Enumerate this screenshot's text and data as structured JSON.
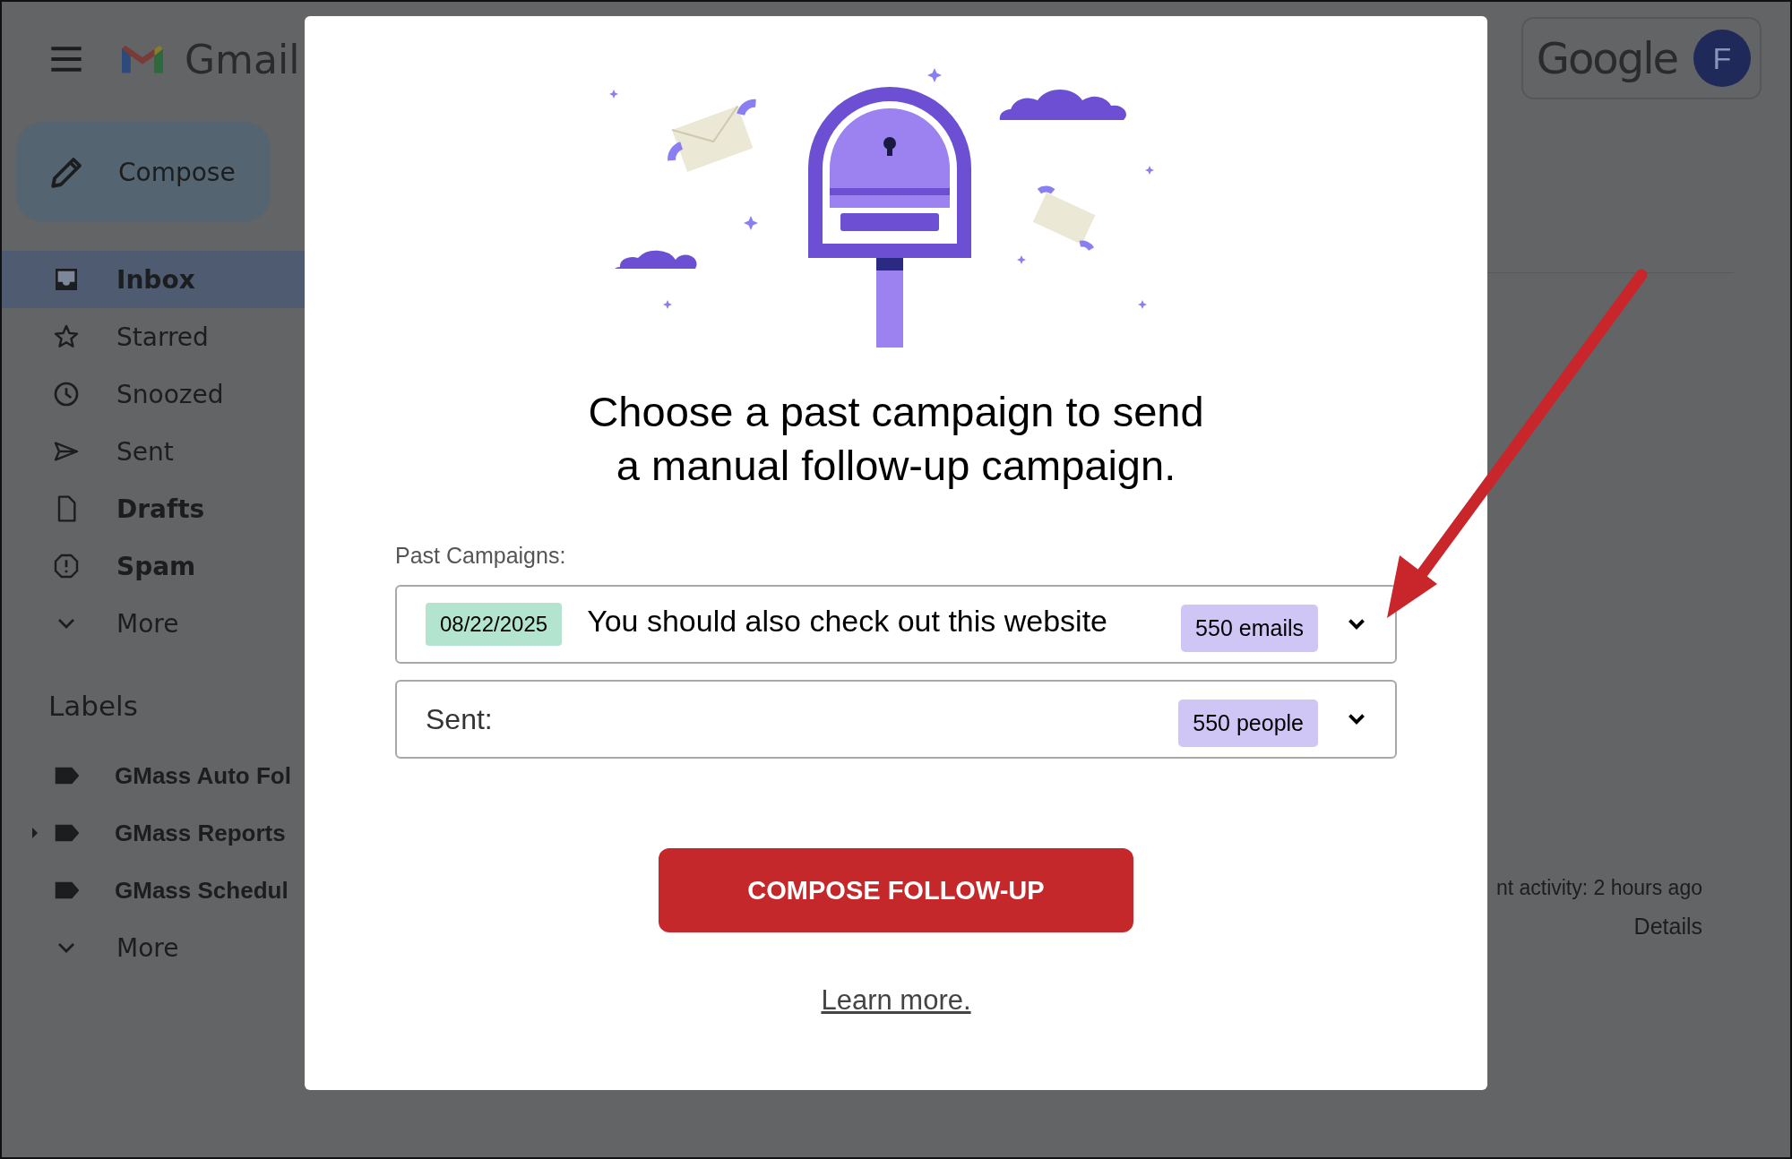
{
  "header": {
    "product": "Gmail",
    "account_logo": "Google",
    "avatar_initial": "F"
  },
  "compose_button": "Compose",
  "folders": [
    {
      "label": "Inbox",
      "kind": "inbox",
      "selected": true,
      "unread": true
    },
    {
      "label": "Starred",
      "kind": "star",
      "selected": false,
      "unread": false
    },
    {
      "label": "Snoozed",
      "kind": "clock",
      "selected": false,
      "unread": false
    },
    {
      "label": "Sent",
      "kind": "send",
      "selected": false,
      "unread": false
    },
    {
      "label": "Drafts",
      "kind": "draft",
      "selected": false,
      "unread": true
    },
    {
      "label": "Spam",
      "kind": "spam",
      "selected": false,
      "unread": true
    },
    {
      "label": "More",
      "kind": "more",
      "selected": false,
      "unread": false
    }
  ],
  "labels": {
    "title": "Labels",
    "items": [
      {
        "label": "GMass Auto Fol",
        "expandable": false
      },
      {
        "label": "GMass Reports",
        "expandable": true
      },
      {
        "label": "GMass Schedul",
        "expandable": false
      }
    ],
    "more": "More"
  },
  "background_activity": {
    "text": "nt activity: 2 hours ago",
    "link": "Details"
  },
  "dialog": {
    "heading_lines": [
      "Choose a past campaign to send",
      "a manual follow-up campaign."
    ],
    "field_label": "Past Campaigns:",
    "campaign_select": {
      "date": "08/22/2025",
      "subject": "You should also check out this website",
      "count": "550 emails"
    },
    "sent_select": {
      "label": "Sent:",
      "count": "550 people"
    },
    "primary_button": "COMPOSE FOLLOW-UP",
    "link": "Learn more."
  }
}
